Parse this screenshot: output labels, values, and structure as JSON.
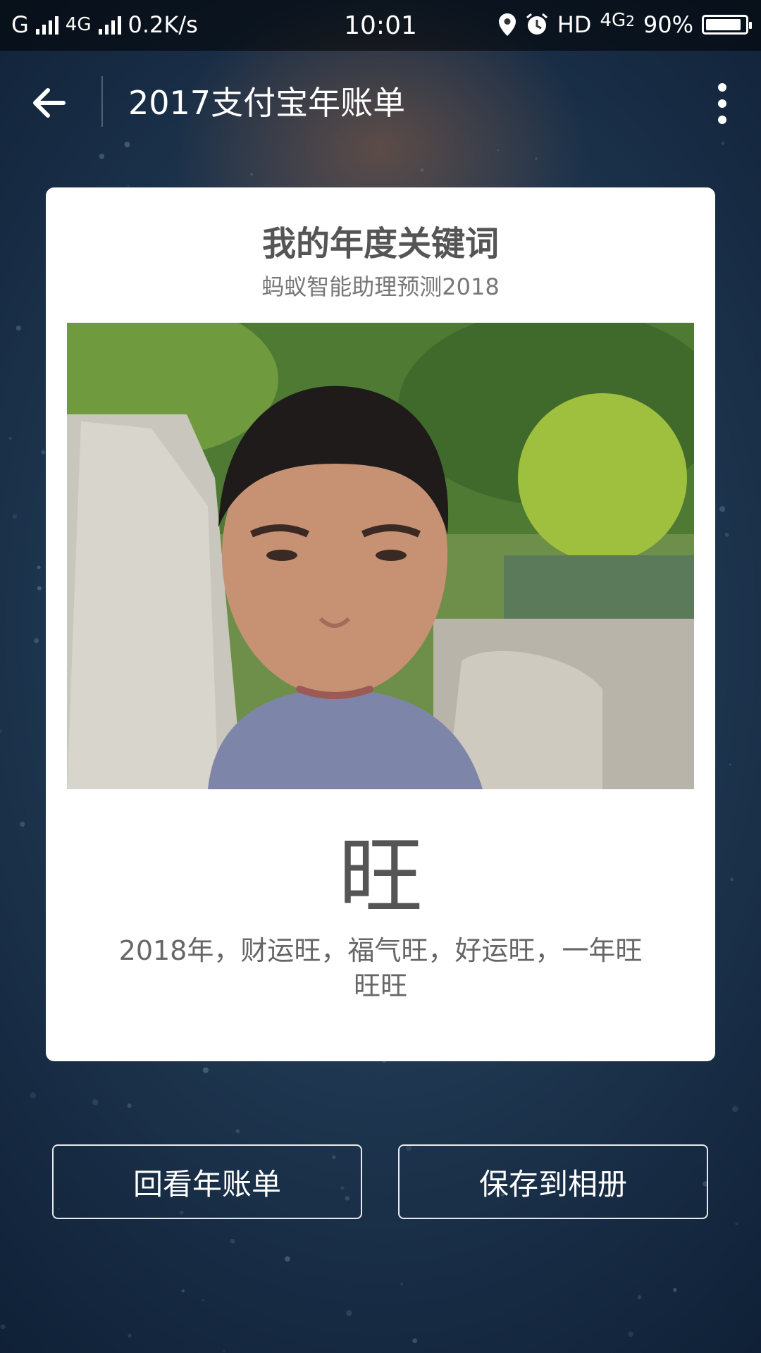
{
  "status_bar": {
    "carrier_left": "G",
    "network_type": "4G",
    "speed": "0.2K/s",
    "time": "10:01",
    "hd_label": "HD",
    "network_right": "4G",
    "network_right_sub": "2",
    "battery_percent_text": "90%",
    "battery_level": 0.9,
    "icons": [
      "signal-icon",
      "location-icon",
      "alarm-icon",
      "battery-icon"
    ]
  },
  "navbar": {
    "title": "2017支付宝年账单",
    "back_icon": "arrow-left-icon",
    "more_icon": "more-vertical-icon"
  },
  "card": {
    "title": "我的年度关键词",
    "subtitle": "蚂蚁智能助理预测2018",
    "photo_alt": "user-photo",
    "keyword": "旺",
    "description": "2018年，财运旺，福气旺，好运旺，一年旺旺旺"
  },
  "actions": {
    "review_label": "回看年账单",
    "save_label": "保存到相册"
  },
  "colors": {
    "background": "#1f3048",
    "card": "#ffffff",
    "title_text": "#555555",
    "subtitle_text": "#777777"
  }
}
